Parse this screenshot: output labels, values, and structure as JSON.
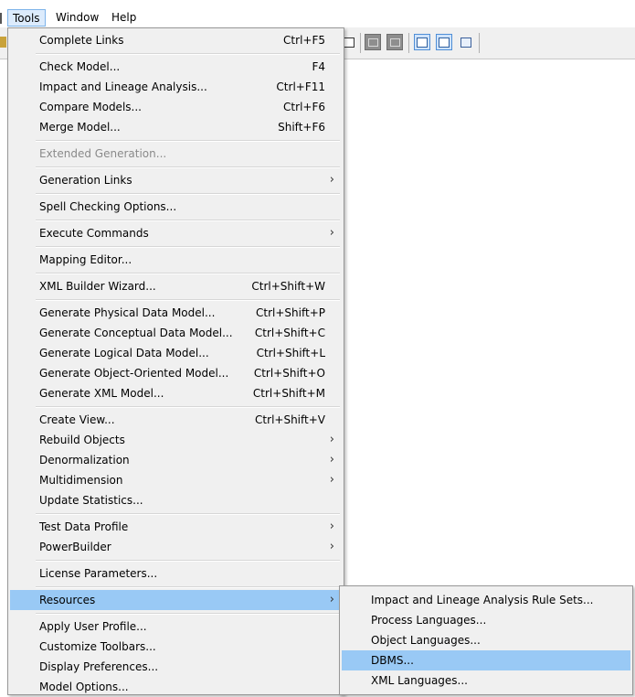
{
  "menubar": {
    "items": [
      {
        "label": "Tools",
        "open": true
      },
      {
        "label": "Window",
        "open": false
      },
      {
        "label": "Help",
        "open": false
      }
    ]
  },
  "tools_menu": {
    "items": [
      {
        "label": "Complete Links",
        "shortcut": "Ctrl+F5"
      },
      {
        "label": "Check Model...",
        "shortcut": "F4"
      },
      {
        "label": "Impact and Lineage Analysis...",
        "shortcut": "Ctrl+F11"
      },
      {
        "label": "Compare Models...",
        "shortcut": "Ctrl+F6"
      },
      {
        "label": "Merge Model...",
        "shortcut": "Shift+F6"
      },
      {
        "label": "Extended Generation...",
        "disabled": true
      },
      {
        "label": "Generation Links",
        "submenu": true
      },
      {
        "label": "Spell Checking Options..."
      },
      {
        "label": "Execute Commands",
        "submenu": true
      },
      {
        "label": "Mapping Editor..."
      },
      {
        "label": "XML Builder Wizard...",
        "shortcut": "Ctrl+Shift+W"
      },
      {
        "label": "Generate Physical Data Model...",
        "shortcut": "Ctrl+Shift+P"
      },
      {
        "label": "Generate Conceptual Data Model...",
        "shortcut": "Ctrl+Shift+C"
      },
      {
        "label": "Generate Logical Data Model...",
        "shortcut": "Ctrl+Shift+L"
      },
      {
        "label": "Generate Object-Oriented Model...",
        "shortcut": "Ctrl+Shift+O"
      },
      {
        "label": "Generate XML Model...",
        "shortcut": "Ctrl+Shift+M"
      },
      {
        "label": "Create View...",
        "shortcut": "Ctrl+Shift+V"
      },
      {
        "label": "Rebuild Objects",
        "submenu": true
      },
      {
        "label": "Denormalization",
        "submenu": true
      },
      {
        "label": "Multidimension",
        "submenu": true
      },
      {
        "label": "Update Statistics..."
      },
      {
        "label": "Test Data Profile",
        "submenu": true
      },
      {
        "label": "PowerBuilder",
        "submenu": true
      },
      {
        "label": "License Parameters..."
      },
      {
        "label": "Resources",
        "submenu": true,
        "highlighted": true
      },
      {
        "label": "Apply User Profile..."
      },
      {
        "label": "Customize Toolbars..."
      },
      {
        "label": "Display Preferences..."
      },
      {
        "label": "Model Options..."
      }
    ],
    "arrow_glyph": "›"
  },
  "resources_submenu": {
    "items": [
      {
        "label": "Impact and Lineage Analysis Rule Sets..."
      },
      {
        "label": "Process Languages..."
      },
      {
        "label": "Object Languages..."
      },
      {
        "label": "DBMS...",
        "highlighted": true
      },
      {
        "label": "XML Languages..."
      }
    ]
  },
  "colors": {
    "highlight": "#99c9f5",
    "menu_bg": "#f0f0f0",
    "menubar_open": "#dcebfc"
  }
}
